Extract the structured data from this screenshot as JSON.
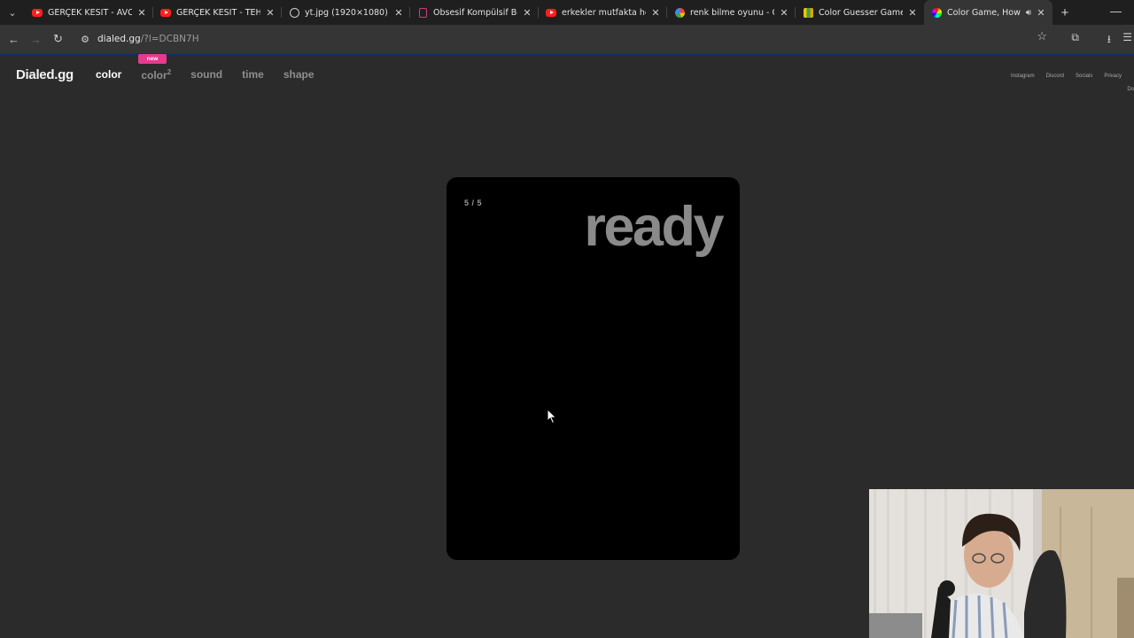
{
  "browser": {
    "tabs": [
      {
        "title": "GERÇEK KESİT - AVCI - Yo",
        "favicon": "youtube-icon",
        "active": false
      },
      {
        "title": "GERÇEK KESİT - TEHLİKELİ",
        "favicon": "youtube-icon",
        "active": false
      },
      {
        "title": "yt.jpg (1920×1080)",
        "favicon": "globe-icon",
        "active": false
      },
      {
        "title": "Obsesif Kompülsif Bozukl",
        "favicon": "document-icon",
        "active": false
      },
      {
        "title": "erkekler mutfakta her işi y",
        "favicon": "youtube-icon",
        "active": false
      },
      {
        "title": "renk bilme oyunu - Goog",
        "favicon": "google-icon",
        "active": false
      },
      {
        "title": "Color Guesser Game | Gu",
        "favicon": "color-guesser-icon",
        "active": false
      },
      {
        "title": "Color Game, How We",
        "favicon": "color-wheel-icon",
        "active": true
      }
    ],
    "url_host": "dialed.gg",
    "url_path": "/?l=DCBN7H"
  },
  "site": {
    "logo": "Dialed.gg",
    "nav": [
      {
        "label": "color",
        "active": true
      },
      {
        "label": "color",
        "suffix": "2",
        "active": false
      },
      {
        "label": "sound",
        "active": false
      },
      {
        "label": "time",
        "active": false
      },
      {
        "label": "shape",
        "active": false
      }
    ],
    "new_badge": "new",
    "links": [
      "Instagram",
      "Discord",
      "Socials",
      "Privacy"
    ],
    "cut_text": "Do"
  },
  "game": {
    "round": "5 / 5",
    "status": "ready"
  },
  "colors": {
    "card": "#000000",
    "background": "#2b2b2b",
    "badge": "#e63a8e"
  }
}
